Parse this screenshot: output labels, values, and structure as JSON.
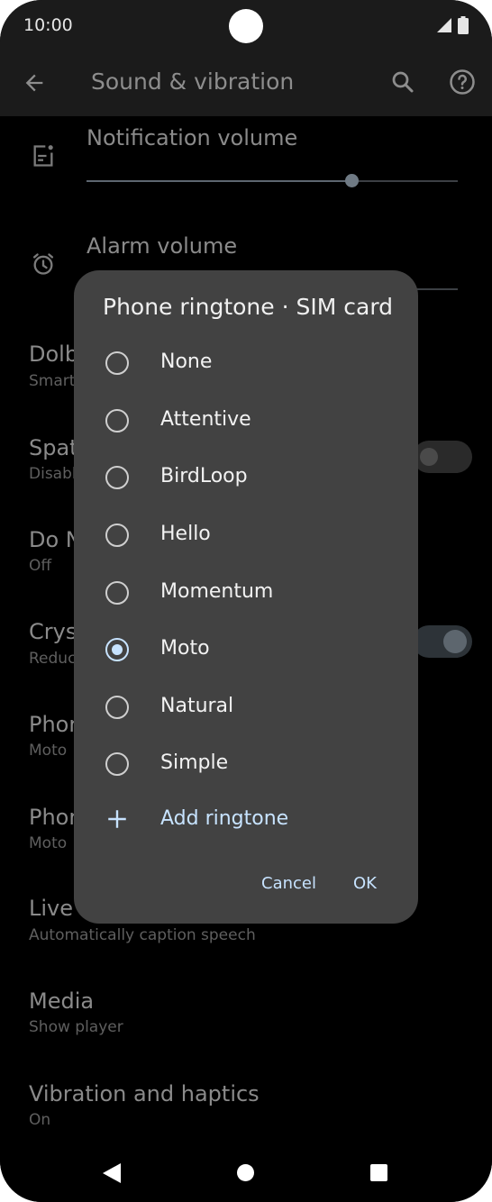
{
  "status_bar": {
    "time": "10:00"
  },
  "app_bar": {
    "title": "Sound & vibration"
  },
  "settings": {
    "notification_volume": {
      "label": "Notification volume",
      "level_percent": 71
    },
    "alarm_volume": {
      "label": "Alarm volume"
    },
    "items": [
      {
        "title": "Dolb",
        "subtitle": "Smart"
      },
      {
        "title": "Spat",
        "subtitle": "Disabl",
        "toggle": "off"
      },
      {
        "title": "Do N",
        "subtitle": "Off"
      },
      {
        "title": "Crys",
        "subtitle": "Reduc",
        "toggle": "on"
      },
      {
        "title": "Phor",
        "subtitle": "Moto"
      },
      {
        "title": "Phor",
        "subtitle": "Moto"
      },
      {
        "title": "Live",
        "subtitle": "Automatically caption speech"
      },
      {
        "title": "Media",
        "subtitle": "Show player"
      },
      {
        "title": "Vibration and haptics",
        "subtitle": "On"
      }
    ]
  },
  "dialog": {
    "title": "Phone ringtone · SIM card",
    "options": [
      {
        "label": "None",
        "selected": false
      },
      {
        "label": "Attentive",
        "selected": false
      },
      {
        "label": "BirdLoop",
        "selected": false
      },
      {
        "label": "Hello",
        "selected": false
      },
      {
        "label": "Momentum",
        "selected": false
      },
      {
        "label": "Moto",
        "selected": true
      },
      {
        "label": "Natural",
        "selected": false
      },
      {
        "label": "Simple",
        "selected": false
      }
    ],
    "add_label": "Add ringtone",
    "cancel_label": "Cancel",
    "ok_label": "OK",
    "accent_color": "#c7e3ff"
  }
}
